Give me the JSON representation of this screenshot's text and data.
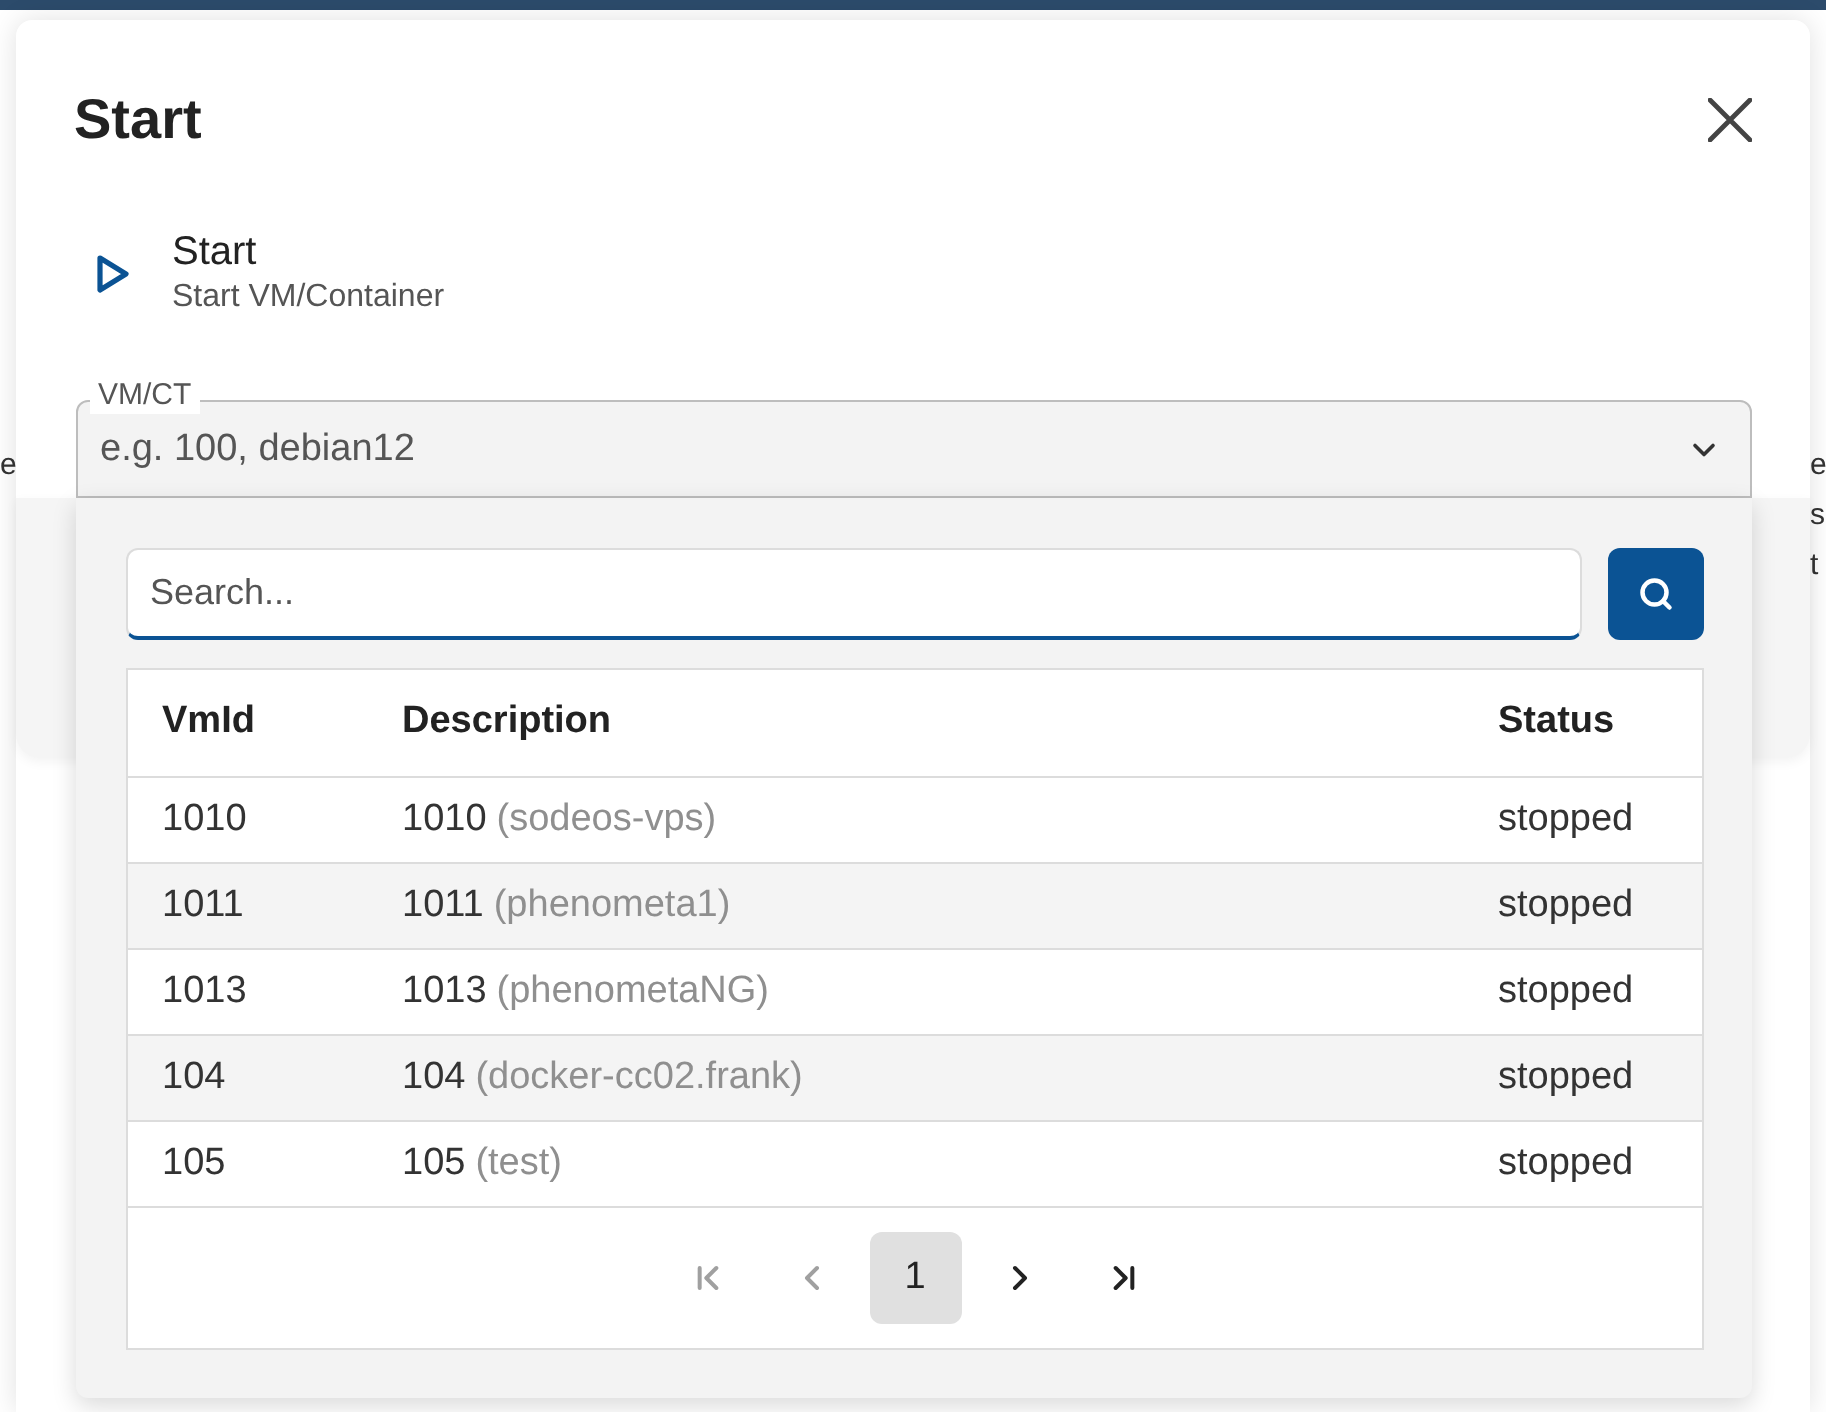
{
  "background_fragments": {
    "left": [
      "e"
    ],
    "right": [
      "e",
      "s",
      "t"
    ]
  },
  "dialog": {
    "title": "Start",
    "action": {
      "title": "Start",
      "subtitle": "Start VM/Container"
    },
    "field": {
      "label": "VM/CT",
      "placeholder": "e.g. 100, debian12",
      "expanded": true
    }
  },
  "dropdown": {
    "search": {
      "placeholder": "Search..."
    },
    "table": {
      "columns": [
        "VmId",
        "Description",
        "Status"
      ],
      "rows": [
        {
          "vmid": "1010",
          "name": "1010",
          "note": "(sodeos-vps)",
          "status": "stopped"
        },
        {
          "vmid": "1011",
          "name": "1011",
          "note": "(phenometa1)",
          "status": "stopped"
        },
        {
          "vmid": "1013",
          "name": "1013",
          "note": "(phenometaNG)",
          "status": "stopped"
        },
        {
          "vmid": "104",
          "name": "104",
          "note": "(docker-cc02.frank)",
          "status": "stopped"
        },
        {
          "vmid": "105",
          "name": "105",
          "note": "(test)",
          "status": "stopped"
        }
      ]
    },
    "pagination": [
      {
        "kind": "first",
        "disabled": true
      },
      {
        "kind": "prev",
        "disabled": true
      },
      {
        "kind": "page",
        "label": "1",
        "selected": true
      },
      {
        "kind": "next",
        "disabled": false
      },
      {
        "kind": "last",
        "disabled": false
      }
    ]
  }
}
